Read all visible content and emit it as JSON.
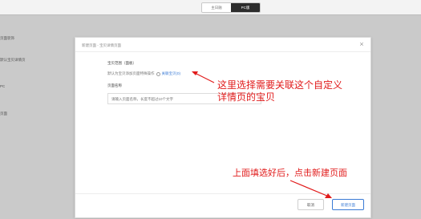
{
  "topbar": {
    "tabs": [
      {
        "label": "主日融",
        "active": false
      },
      {
        "label": "PC版",
        "active": true
      }
    ]
  },
  "background_labels": [
    "页面装饰",
    "默认宝贝详情页",
    "PC",
    "页面"
  ],
  "modal": {
    "title": "新建页面 - 宝贝详情页面",
    "section_scope_label": "宝贝范围（面板）",
    "scope_hint": "默认为宝贝添加页面特殊操作",
    "scope_link": "关联宝贝(0)",
    "name_label": "页面名称",
    "name_placeholder": "请输入页面名称，长度不超过10个文字",
    "cancel_label": "取消",
    "create_label": "新建页面"
  },
  "annotations": {
    "line1": "这里选择需要关联这个自定义",
    "line2": "详情页的宝贝",
    "line3": "上面填选好后，点击新建页面"
  },
  "colors": {
    "annotation": "#e11b1b",
    "link": "#3a7bd5",
    "tab_active_bg": "#2d2d2d"
  }
}
